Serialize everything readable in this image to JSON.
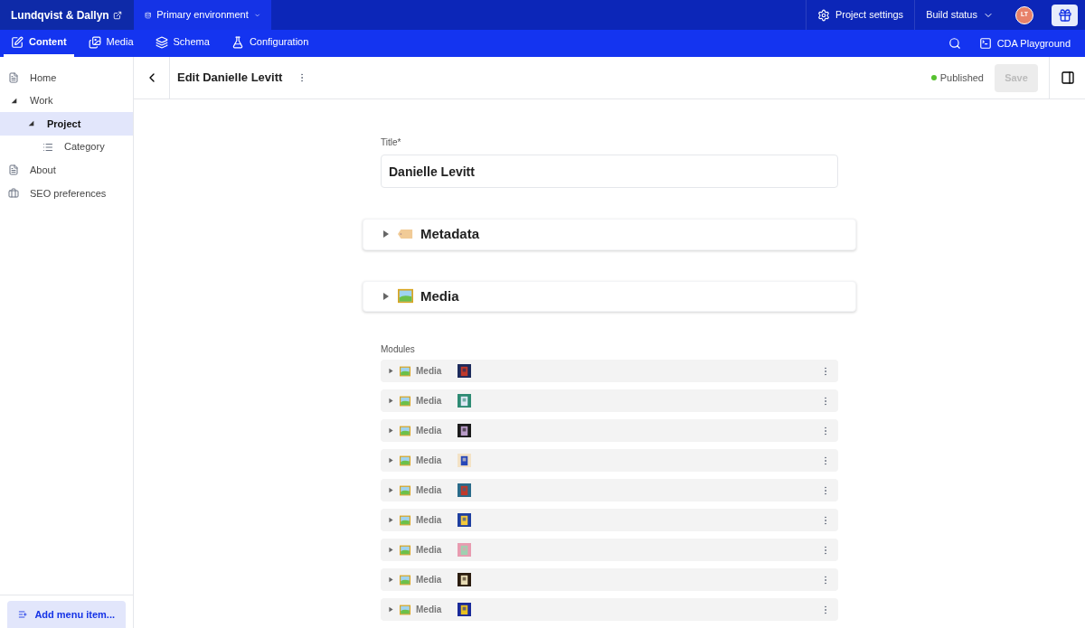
{
  "project": {
    "name": "Lundqvist & Dallyn"
  },
  "environment": {
    "label": "Primary environment"
  },
  "top_actions": {
    "settings": "Project settings",
    "build": "Build status",
    "avatar": "LT"
  },
  "tabs": [
    {
      "label": "Content",
      "selected": true,
      "kind": "content"
    },
    {
      "label": "Media",
      "selected": false,
      "kind": "media"
    },
    {
      "label": "Schema",
      "selected": false,
      "kind": "schema"
    },
    {
      "label": "Configuration",
      "selected": false,
      "kind": "config"
    }
  ],
  "playground": "CDA Playground",
  "sidebar": {
    "items": [
      {
        "label": "Home",
        "kind": "page",
        "selected": false
      },
      {
        "label": "Work",
        "kind": "folder",
        "selected": false,
        "expanded": true,
        "children": [
          {
            "label": "Project",
            "kind": "folder",
            "selected": true,
            "expanded": true,
            "children": [
              {
                "label": "Category",
                "kind": "list",
                "selected": false
              }
            ]
          }
        ]
      },
      {
        "label": "About",
        "kind": "page",
        "selected": false
      },
      {
        "label": "SEO preferences",
        "kind": "settings",
        "selected": false
      }
    ],
    "add_button": "Add menu item..."
  },
  "editor": {
    "title": "Edit Danielle Levitt",
    "status": "Published",
    "save": "Save",
    "save_disabled": true,
    "title_field": {
      "label": "Title*",
      "value": "Danielle Levitt"
    },
    "sections": [
      {
        "label": "Metadata",
        "kind": "tag",
        "expanded": false
      },
      {
        "label": "Media",
        "kind": "frame",
        "expanded": false
      }
    ],
    "modules_label": "Modules",
    "modules": [
      {
        "label": "Media"
      },
      {
        "label": "Media"
      },
      {
        "label": "Media"
      },
      {
        "label": "Media"
      },
      {
        "label": "Media"
      },
      {
        "label": "Media"
      },
      {
        "label": "Media"
      },
      {
        "label": "Media"
      },
      {
        "label": "Media"
      }
    ]
  }
}
